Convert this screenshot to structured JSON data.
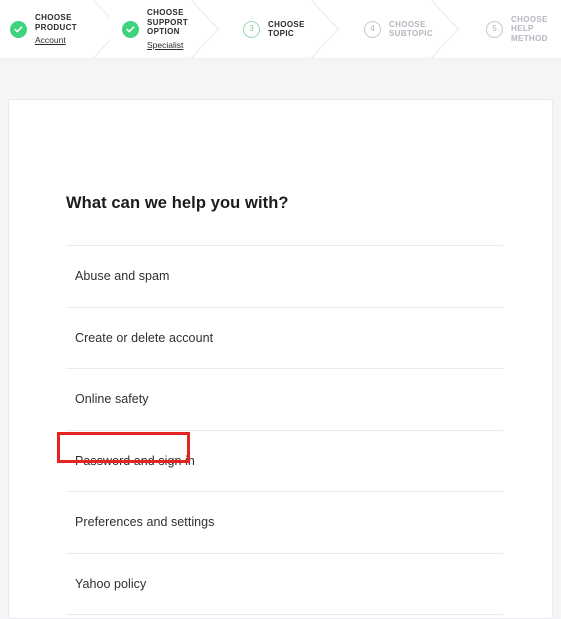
{
  "stepper": {
    "steps": [
      {
        "id": "product",
        "state": "completed",
        "marker": "check-icon",
        "title": "CHOOSE\nPRODUCT",
        "link": "Account"
      },
      {
        "id": "support-option",
        "state": "completed",
        "marker": "check-icon",
        "title": "CHOOSE\nSUPPORT\nOPTION",
        "link": "Specialist"
      },
      {
        "id": "topic",
        "state": "current",
        "marker": "3",
        "title": "CHOOSE\nTOPIC",
        "link": ""
      },
      {
        "id": "subtopic",
        "state": "pending",
        "marker": "4",
        "title": "CHOOSE\nSUBTOPIC",
        "link": ""
      },
      {
        "id": "help-method",
        "state": "pending",
        "marker": "5",
        "title": "CHOOSE\nHELP\nMETHOD",
        "link": ""
      }
    ]
  },
  "main": {
    "heading": "What can we help you with?",
    "topics": [
      {
        "label": "Abuse and spam",
        "highlighted": false
      },
      {
        "label": "Create or delete account",
        "highlighted": false
      },
      {
        "label": "Online safety",
        "highlighted": false
      },
      {
        "label": "Password and sign in",
        "highlighted": true
      },
      {
        "label": "Preferences and settings",
        "highlighted": false
      },
      {
        "label": "Yahoo policy",
        "highlighted": false
      }
    ]
  },
  "colors": {
    "page_background": "#f4f5f7",
    "card_background": "#ffffff",
    "completed_step": "#3fd37e",
    "current_step": "#9bd8b4",
    "pending_step": "#c6c9cf",
    "highlight_border": "#e52421",
    "divider": "#e9eaec",
    "text_primary": "#2f2f2f"
  }
}
